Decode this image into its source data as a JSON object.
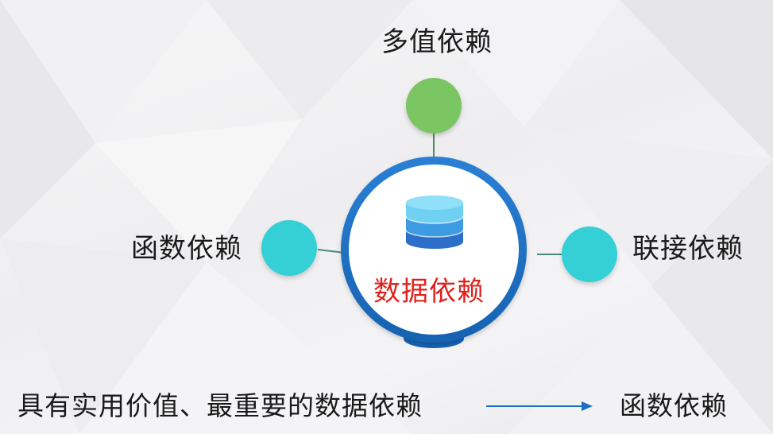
{
  "diagram": {
    "center": {
      "label": "数据依赖",
      "ring_color": "#1c6fc4",
      "label_color": "#e0201b",
      "icon": "database-icon"
    },
    "nodes": {
      "top": {
        "label": "多值依赖",
        "color": "#7cc563"
      },
      "left": {
        "label": "函数依赖",
        "color": "#35cfd6"
      },
      "right": {
        "label": "联接依赖",
        "color": "#35cfd6"
      }
    },
    "conclusion": {
      "text": "具有实用价值、最重要的数据依赖",
      "result": "函数依赖",
      "arrow_color": "#1c6fc4"
    }
  }
}
